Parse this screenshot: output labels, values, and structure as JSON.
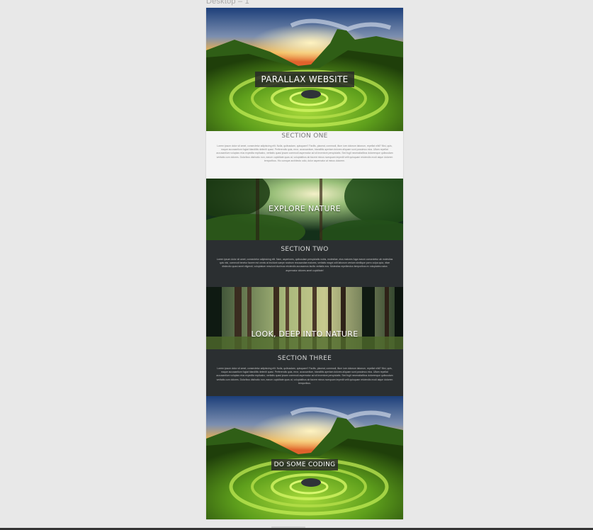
{
  "artboard": {
    "label": "Desktop – 1"
  },
  "heroes": [
    {
      "title": "PARALLAX WEBSITE",
      "scene": "green valley with spiral moss circles at sunset"
    },
    {
      "title": "EXPLORE NATURE",
      "scene": "sunlit forest canopy"
    },
    {
      "title": "LOOK, DEEP INTO NATURE",
      "scene": "dense forest tree trunks"
    },
    {
      "title": "DO SOME CODING",
      "scene": "green valley with spiral moss circles at sunset"
    }
  ],
  "sections": [
    {
      "heading": "SECTION ONE",
      "body": "Lorem ipsum dolor sit amet, consectetur adipisicing elit. Nulla, quibusdam, quisquam? Facilis, placeat, commodi, illum iure dolorum laborum, repellat nihil? Nisi, quis, eaque accusantium fugiat blanditiis deleniti quasi. Perferendis quia, error, accusantium, blanditiis aperiam dolores aliquam sunt possimus eius. Ullam repellat accusantium voluptas eius expedita explicabo, veritatis quasi ipsam commodi aspernatur ad sit inventore perspiciatis. Sed fugit necessitatibus doloremque quibusdam veritatis cum dolores. Doloribus distinctio non, earum cupiditate quas at, voluptatibus ab facere minus numquam impedit velit quisquam reiciendis modi atque dolorem temporibus. Hic cumque architecto odio, dolor aspernatur at minus dolorem."
    },
    {
      "heading": "SECTION TWO",
      "body": "Lorem ipsum dolor sit amet, consectetur adipisicing elit. Nam, asperiores, quibusdam perspiciatis nobis, molestiae, eius maiores fuga earum consectetur ab molestias quis nisi, commodi tenetur facere est omnis at incidunt saepe nostrum recusandae maiores, veritatis magni odit laborum veniam similique porro culpa quia, vitae distinctio quasi amet eligendi, voluptatum nesciunt ducimus reiciendis accusamus facilis veritatis eos. Molestias repellendus temporibus ex voluptates natus aspernatur dolores amet cupiditate!"
    },
    {
      "heading": "SECTION THREE",
      "body": "Lorem ipsum dolor sit amet, consectetur adipisicing elit. Nulla, quibusdam, quisquam? Facilis, placeat, commodi, illum iure dolorum laborum, repellat nihil? Nisi, quis, eaque accusantium fugiat blanditiis deleniti quasi. Perferendis quia, error, accusantium, blanditiis aperiam dolores aliquam sunt possimus eius. Ullam repellat accusantium voluptas eius expedita explicabo, veritatis quasi ipsam commodi aspernatur ad sit inventore perspiciatis. Sed fugit necessitatibus doloremque quibusdam veritatis cum dolores. Doloribus distinctio non, earum cupiditate quas at, voluptatibus ab facere minus numquam impedit velit quisquam reiciendis modi atque dolorem temporibus."
    }
  ],
  "colors": {
    "canvas": "#e8e8e8",
    "light_section": "#f4f4f4",
    "dark_section": "#2b2f31",
    "title_box": "#282828"
  }
}
